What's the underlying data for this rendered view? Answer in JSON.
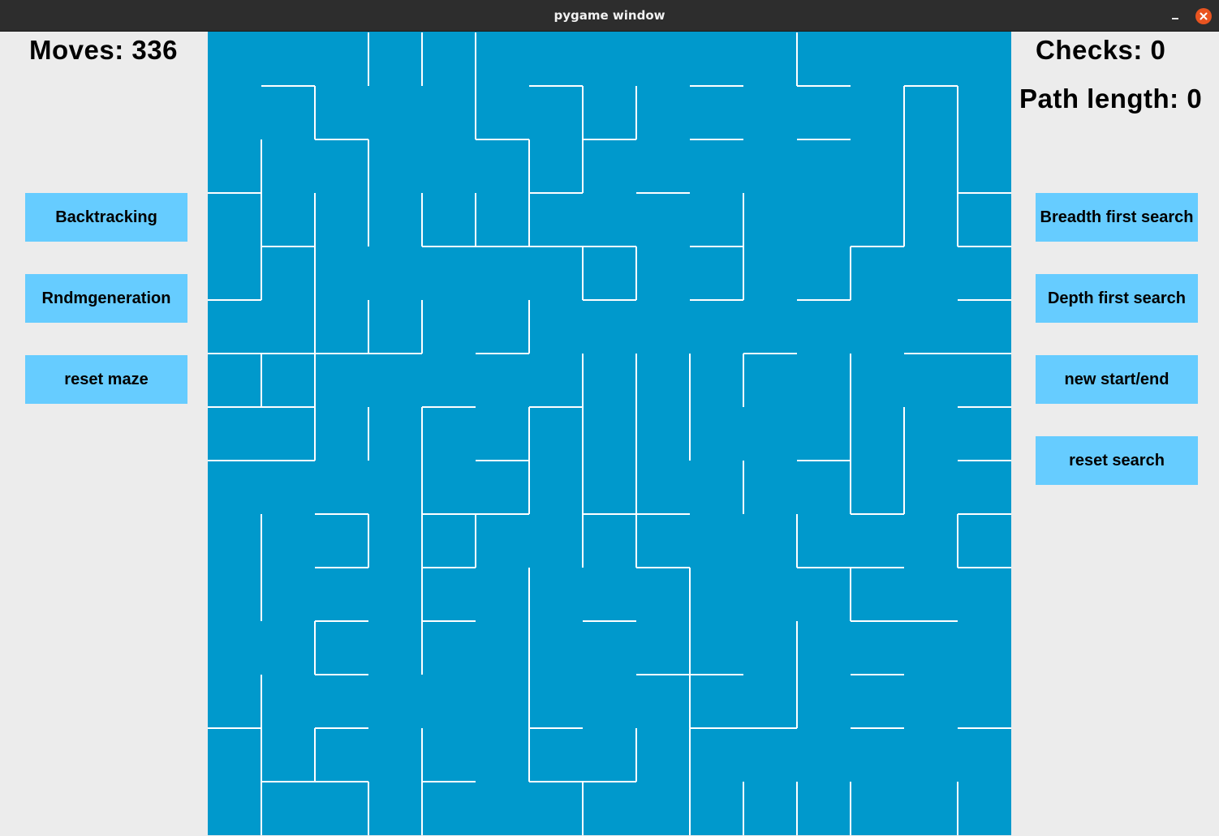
{
  "window": {
    "title": "pygame window",
    "controls": [
      "minimize",
      "close"
    ]
  },
  "stats": {
    "moves_label": "Moves: 336",
    "checks_label": "Checks: 0",
    "path_length_label": "Path length: 0"
  },
  "left_buttons": {
    "backtracking": "Backtracking",
    "random_generation": "Rndmgeneration",
    "reset_maze": "reset maze"
  },
  "right_buttons": {
    "bfs": "Breadth first search",
    "dfs": "Depth first search",
    "new_start_end": "new start/end",
    "reset_search": "reset search"
  },
  "colors": {
    "background": "#ececec",
    "maze_fill": "#0099cc",
    "maze_wall": "#ffffff",
    "button": "#66ccff",
    "titlebar": "#2d2d2d",
    "close": "#e95420"
  },
  "maze": {
    "cols": 15,
    "rows": 15,
    "horizontal_walls": [
      [
        1,
        0
      ],
      [
        6,
        0
      ],
      [
        9,
        0
      ],
      [
        11,
        0
      ],
      [
        13,
        0
      ],
      [
        2,
        1
      ],
      [
        5,
        1
      ],
      [
        7,
        1
      ],
      [
        9,
        1
      ],
      [
        11,
        1
      ],
      [
        0,
        2
      ],
      [
        6,
        2
      ],
      [
        8,
        2
      ],
      [
        14,
        2
      ],
      [
        1,
        3
      ],
      [
        4,
        3
      ],
      [
        5,
        3
      ],
      [
        6,
        3
      ],
      [
        7,
        3
      ],
      [
        9,
        3
      ],
      [
        12,
        3
      ],
      [
        14,
        3
      ],
      [
        0,
        4
      ],
      [
        7,
        4
      ],
      [
        9,
        4
      ],
      [
        11,
        4
      ],
      [
        14,
        4
      ],
      [
        0,
        5
      ],
      [
        1,
        5
      ],
      [
        2,
        5
      ],
      [
        3,
        5
      ],
      [
        5,
        5
      ],
      [
        10,
        5
      ],
      [
        13,
        5
      ],
      [
        14,
        5
      ],
      [
        0,
        6
      ],
      [
        1,
        6
      ],
      [
        4,
        6
      ],
      [
        6,
        6
      ],
      [
        14,
        6
      ],
      [
        0,
        7
      ],
      [
        1,
        7
      ],
      [
        5,
        7
      ],
      [
        11,
        7
      ],
      [
        14,
        7
      ],
      [
        2,
        8
      ],
      [
        4,
        8
      ],
      [
        5,
        8
      ],
      [
        7,
        8
      ],
      [
        8,
        8
      ],
      [
        12,
        8
      ],
      [
        14,
        8
      ],
      [
        2,
        9
      ],
      [
        4,
        9
      ],
      [
        8,
        9
      ],
      [
        11,
        9
      ],
      [
        12,
        9
      ],
      [
        14,
        9
      ],
      [
        2,
        10
      ],
      [
        4,
        10
      ],
      [
        7,
        10
      ],
      [
        12,
        10
      ],
      [
        13,
        10
      ],
      [
        2,
        11
      ],
      [
        8,
        11
      ],
      [
        9,
        11
      ],
      [
        12,
        11
      ],
      [
        0,
        12
      ],
      [
        2,
        12
      ],
      [
        6,
        12
      ],
      [
        9,
        12
      ],
      [
        10,
        12
      ],
      [
        12,
        12
      ],
      [
        14,
        12
      ],
      [
        1,
        13
      ],
      [
        2,
        13
      ],
      [
        4,
        13
      ],
      [
        6,
        13
      ],
      [
        7,
        13
      ]
    ],
    "vertical_walls": [
      [
        3,
        0
      ],
      [
        4,
        0
      ],
      [
        5,
        0
      ],
      [
        11,
        0
      ],
      [
        2,
        1
      ],
      [
        5,
        1
      ],
      [
        7,
        1
      ],
      [
        8,
        1
      ],
      [
        13,
        1
      ],
      [
        14,
        1
      ],
      [
        1,
        2
      ],
      [
        3,
        2
      ],
      [
        6,
        2
      ],
      [
        7,
        2
      ],
      [
        13,
        2
      ],
      [
        14,
        2
      ],
      [
        1,
        3
      ],
      [
        2,
        3
      ],
      [
        3,
        3
      ],
      [
        4,
        3
      ],
      [
        5,
        3
      ],
      [
        6,
        3
      ],
      [
        10,
        3
      ],
      [
        13,
        3
      ],
      [
        14,
        3
      ],
      [
        1,
        4
      ],
      [
        2,
        4
      ],
      [
        7,
        4
      ],
      [
        8,
        4
      ],
      [
        10,
        4
      ],
      [
        12,
        4
      ],
      [
        2,
        5
      ],
      [
        3,
        5
      ],
      [
        4,
        5
      ],
      [
        6,
        5
      ],
      [
        1,
        6
      ],
      [
        2,
        6
      ],
      [
        7,
        6
      ],
      [
        8,
        6
      ],
      [
        9,
        6
      ],
      [
        10,
        6
      ],
      [
        12,
        6
      ],
      [
        2,
        7
      ],
      [
        3,
        7
      ],
      [
        4,
        7
      ],
      [
        6,
        7
      ],
      [
        7,
        7
      ],
      [
        8,
        7
      ],
      [
        9,
        7
      ],
      [
        12,
        7
      ],
      [
        13,
        7
      ],
      [
        4,
        8
      ],
      [
        6,
        8
      ],
      [
        7,
        8
      ],
      [
        8,
        8
      ],
      [
        10,
        8
      ],
      [
        12,
        8
      ],
      [
        13,
        8
      ],
      [
        1,
        9
      ],
      [
        3,
        9
      ],
      [
        4,
        9
      ],
      [
        5,
        9
      ],
      [
        7,
        9
      ],
      [
        8,
        9
      ],
      [
        11,
        9
      ],
      [
        14,
        9
      ],
      [
        1,
        10
      ],
      [
        4,
        10
      ],
      [
        6,
        10
      ],
      [
        9,
        10
      ],
      [
        12,
        10
      ],
      [
        2,
        11
      ],
      [
        4,
        11
      ],
      [
        6,
        11
      ],
      [
        9,
        11
      ],
      [
        11,
        11
      ],
      [
        1,
        12
      ],
      [
        6,
        12
      ],
      [
        9,
        12
      ],
      [
        11,
        12
      ],
      [
        1,
        13
      ],
      [
        2,
        13
      ],
      [
        4,
        13
      ],
      [
        6,
        13
      ],
      [
        8,
        13
      ],
      [
        9,
        13
      ],
      [
        1,
        14
      ],
      [
        3,
        14
      ],
      [
        4,
        14
      ],
      [
        7,
        14
      ],
      [
        9,
        14
      ],
      [
        10,
        14
      ],
      [
        11,
        14
      ],
      [
        12,
        14
      ],
      [
        14,
        14
      ]
    ]
  }
}
